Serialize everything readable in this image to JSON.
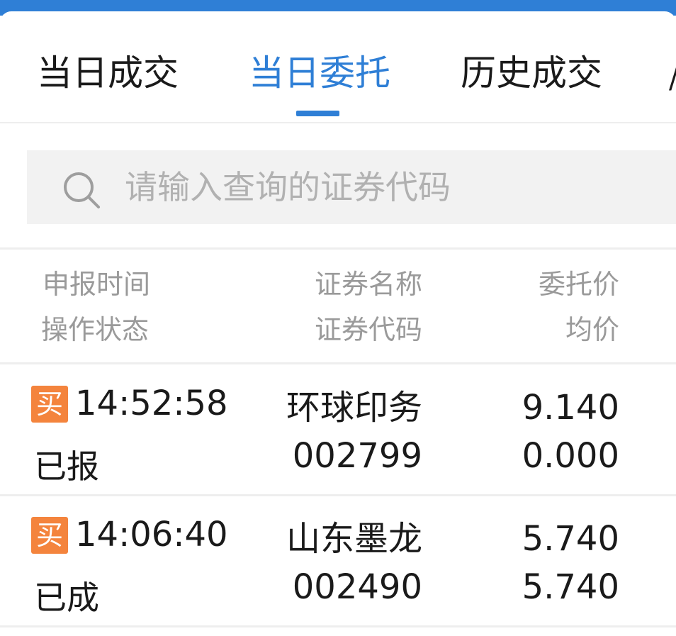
{
  "tabs": [
    {
      "label": "当日成交",
      "active": false
    },
    {
      "label": "当日委托",
      "active": true
    },
    {
      "label": "历史成交",
      "active": false
    }
  ],
  "search": {
    "placeholder": "请输入查询的证券代码",
    "value": ""
  },
  "columns": {
    "report_time": "申报时间",
    "op_status": "操作状态",
    "sec_name": "证券名称",
    "sec_code": "证券代码",
    "order_price": "委托价",
    "avg_price": "均价"
  },
  "orders": [
    {
      "side": "买",
      "time": "14:52:58",
      "status": "已报",
      "name": "环球印务",
      "code": "002799",
      "price": "9.140",
      "avg": "0.000"
    },
    {
      "side": "买",
      "time": "14:06:40",
      "status": "已成",
      "name": "山东墨龙",
      "code": "002490",
      "price": "5.740",
      "avg": "5.740"
    }
  ],
  "colors": {
    "accent": "#2f7fd6",
    "buy_badge": "#f4843d",
    "muted_text": "#9a9a9a",
    "placeholder": "#b1b1b1"
  },
  "icons": {
    "search": "search-icon"
  }
}
